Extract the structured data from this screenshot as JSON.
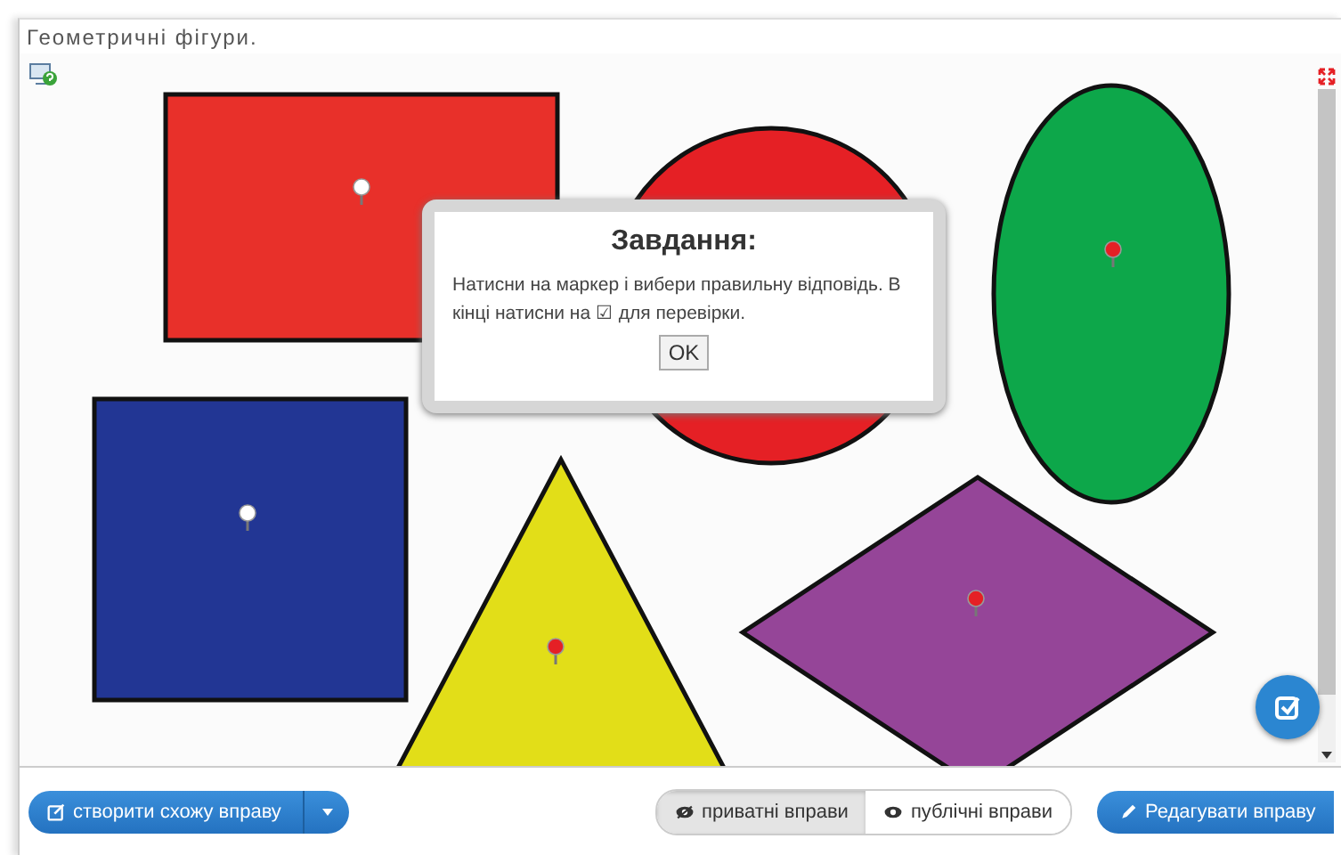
{
  "window": {
    "title": "Геометричні фігури."
  },
  "shapes": [
    {
      "kind": "rectangle",
      "color": "#e8302a",
      "marker_active": false
    },
    {
      "kind": "circle",
      "color": "#e52025"
    },
    {
      "kind": "ellipse",
      "color": "#0da74a",
      "marker_active": true
    },
    {
      "kind": "square",
      "color": "#223694",
      "marker_active": false
    },
    {
      "kind": "triangle",
      "color": "#e2de18",
      "marker_active": true
    },
    {
      "kind": "rhombus",
      "color": "#954598",
      "marker_active": true
    }
  ],
  "dialog": {
    "title": "Завдання:",
    "text": "Натисни на маркер і вибери правильну відповідь. В кінці натисни на ☑ для перевірки.",
    "button": "OK"
  },
  "footer": {
    "create_button": "створити схожу вправу",
    "toggle": [
      {
        "label": "приватні вправи",
        "selected": true
      },
      {
        "label": "публічні вправи",
        "selected": false
      }
    ],
    "edit_button": "Редагувати вправу"
  }
}
